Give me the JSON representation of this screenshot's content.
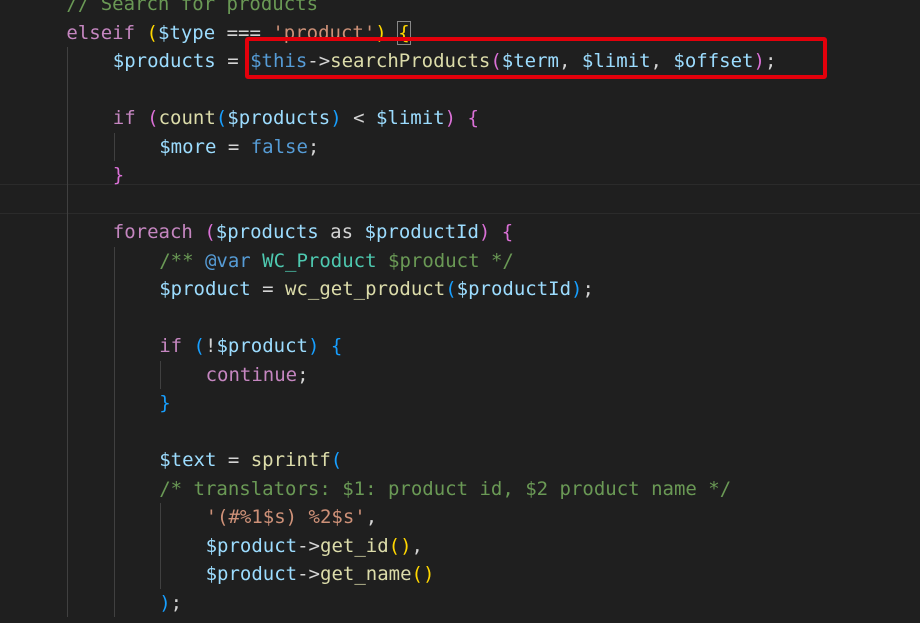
{
  "editor": {
    "colors": {
      "background": "#1f1f1f",
      "keyword": "#c586c0",
      "variable": "#9cdcfe",
      "function": "#dcdcaa",
      "string": "#ce9178",
      "comment": "#6a9955",
      "highlight_box": "#e3000b"
    },
    "lines": [
      {
        "indent": 1,
        "tokens": [
          {
            "t": "// Search for products",
            "c": "comment"
          }
        ]
      },
      {
        "indent": 1,
        "tokens": [
          {
            "t": "elseif",
            "c": "kw-ctrl"
          },
          {
            "t": " ",
            "c": "op"
          },
          {
            "t": "(",
            "c": "b1"
          },
          {
            "t": "$type",
            "c": "var"
          },
          {
            "t": " === ",
            "c": "op"
          },
          {
            "t": "'product'",
            "c": "str"
          },
          {
            "t": ")",
            "c": "b1"
          },
          {
            "t": " ",
            "c": "op"
          },
          {
            "t": "{",
            "c": "b1 bracket-match"
          }
        ]
      },
      {
        "indent": 2,
        "tokens": [
          {
            "t": "$products",
            "c": "var"
          },
          {
            "t": " = ",
            "c": "op"
          },
          {
            "t": "$this",
            "c": "var-this"
          },
          {
            "t": "->",
            "c": "op"
          },
          {
            "t": "searchProducts",
            "c": "fn"
          },
          {
            "t": "(",
            "c": "b2"
          },
          {
            "t": "$term",
            "c": "var"
          },
          {
            "t": ", ",
            "c": "op"
          },
          {
            "t": "$limit",
            "c": "var"
          },
          {
            "t": ", ",
            "c": "op"
          },
          {
            "t": "$offset",
            "c": "var"
          },
          {
            "t": ")",
            "c": "b2"
          },
          {
            "t": ";",
            "c": "op"
          }
        ]
      },
      {
        "indent": 0,
        "tokens": []
      },
      {
        "indent": 2,
        "tokens": [
          {
            "t": "if",
            "c": "kw-ctrl"
          },
          {
            "t": " ",
            "c": "op"
          },
          {
            "t": "(",
            "c": "b2"
          },
          {
            "t": "count",
            "c": "fn"
          },
          {
            "t": "(",
            "c": "b3"
          },
          {
            "t": "$products",
            "c": "var"
          },
          {
            "t": ")",
            "c": "b3"
          },
          {
            "t": " < ",
            "c": "op"
          },
          {
            "t": "$limit",
            "c": "var"
          },
          {
            "t": ")",
            "c": "b2"
          },
          {
            "t": " ",
            "c": "op"
          },
          {
            "t": "{",
            "c": "b2"
          }
        ]
      },
      {
        "indent": 3,
        "tokens": [
          {
            "t": "$more",
            "c": "var"
          },
          {
            "t": " = ",
            "c": "op"
          },
          {
            "t": "false",
            "c": "var-this"
          },
          {
            "t": ";",
            "c": "op"
          }
        ]
      },
      {
        "indent": 2,
        "tokens": [
          {
            "t": "}",
            "c": "b2"
          }
        ]
      },
      {
        "indent": 0,
        "tokens": []
      },
      {
        "indent": 2,
        "tokens": [
          {
            "t": "foreach",
            "c": "kw-ctrl"
          },
          {
            "t": " ",
            "c": "op"
          },
          {
            "t": "(",
            "c": "b2"
          },
          {
            "t": "$products",
            "c": "var"
          },
          {
            "t": " as ",
            "c": "op"
          },
          {
            "t": "$productId",
            "c": "var"
          },
          {
            "t": ")",
            "c": "b2"
          },
          {
            "t": " ",
            "c": "op"
          },
          {
            "t": "{",
            "c": "b2"
          }
        ]
      },
      {
        "indent": 3,
        "tokens": [
          {
            "t": "/** ",
            "c": "comment"
          },
          {
            "t": "@var",
            "c": "doc-tag"
          },
          {
            "t": " ",
            "c": "comment"
          },
          {
            "t": "WC_Product",
            "c": "doc-type"
          },
          {
            "t": " $product */",
            "c": "comment"
          }
        ]
      },
      {
        "indent": 3,
        "tokens": [
          {
            "t": "$product",
            "c": "var"
          },
          {
            "t": " = ",
            "c": "op"
          },
          {
            "t": "wc_get_product",
            "c": "fn"
          },
          {
            "t": "(",
            "c": "b3"
          },
          {
            "t": "$productId",
            "c": "var"
          },
          {
            "t": ")",
            "c": "b3"
          },
          {
            "t": ";",
            "c": "op"
          }
        ]
      },
      {
        "indent": 0,
        "tokens": []
      },
      {
        "indent": 3,
        "tokens": [
          {
            "t": "if",
            "c": "kw-ctrl"
          },
          {
            "t": " ",
            "c": "op"
          },
          {
            "t": "(",
            "c": "b3"
          },
          {
            "t": "!",
            "c": "op"
          },
          {
            "t": "$product",
            "c": "var"
          },
          {
            "t": ")",
            "c": "b3"
          },
          {
            "t": " ",
            "c": "op"
          },
          {
            "t": "{",
            "c": "b3"
          }
        ]
      },
      {
        "indent": 4,
        "tokens": [
          {
            "t": "continue",
            "c": "kw-ctrl"
          },
          {
            "t": ";",
            "c": "op"
          }
        ]
      },
      {
        "indent": 3,
        "tokens": [
          {
            "t": "}",
            "c": "b3"
          }
        ]
      },
      {
        "indent": 0,
        "tokens": []
      },
      {
        "indent": 3,
        "tokens": [
          {
            "t": "$text",
            "c": "var"
          },
          {
            "t": " = ",
            "c": "op"
          },
          {
            "t": "sprintf",
            "c": "fn"
          },
          {
            "t": "(",
            "c": "b3"
          }
        ]
      },
      {
        "indent": 3,
        "tokens": [
          {
            "t": "/* translators: $1: product id, $2 product name */",
            "c": "comment"
          }
        ]
      },
      {
        "indent": 4,
        "tokens": [
          {
            "t": "'(#%1$s) %2$s'",
            "c": "str"
          },
          {
            "t": ",",
            "c": "op"
          }
        ]
      },
      {
        "indent": 4,
        "tokens": [
          {
            "t": "$product",
            "c": "var"
          },
          {
            "t": "->",
            "c": "op"
          },
          {
            "t": "get_id",
            "c": "fn"
          },
          {
            "t": "(",
            "c": "b1"
          },
          {
            "t": ")",
            "c": "b1"
          },
          {
            "t": ",",
            "c": "op"
          }
        ]
      },
      {
        "indent": 4,
        "tokens": [
          {
            "t": "$product",
            "c": "var"
          },
          {
            "t": "->",
            "c": "op"
          },
          {
            "t": "get_name",
            "c": "fn"
          },
          {
            "t": "(",
            "c": "b1"
          },
          {
            "t": ")",
            "c": "b1"
          }
        ]
      },
      {
        "indent": 3,
        "tokens": [
          {
            "t": ")",
            "c": "b3"
          },
          {
            "t": ";",
            "c": "op"
          }
        ]
      }
    ]
  }
}
